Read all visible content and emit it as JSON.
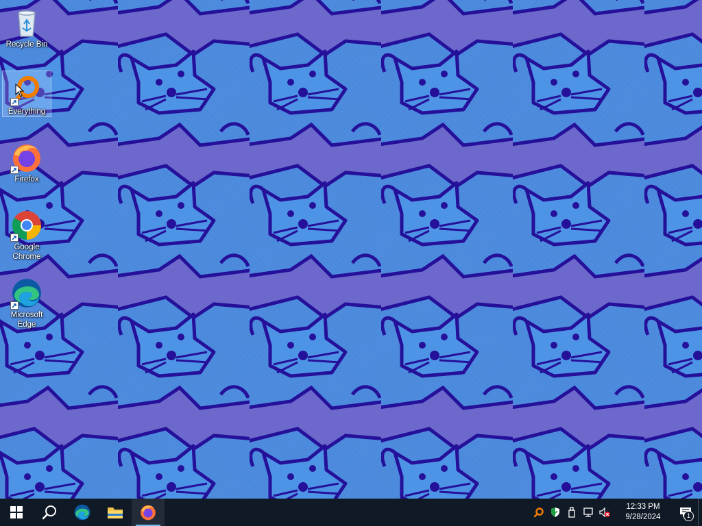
{
  "desktop": {
    "icons": [
      {
        "label": "Recycle Bin",
        "icon": "recycle-bin-icon"
      },
      {
        "label": "Everything",
        "icon": "everything-search-icon"
      },
      {
        "label": "Firefox",
        "icon": "firefox-icon"
      },
      {
        "label": "Google Chrome",
        "icon": "chrome-icon"
      },
      {
        "label": "Microsoft Edge",
        "icon": "edge-icon"
      }
    ]
  },
  "taskbar": {
    "buttons": [
      "windows-start-icon",
      "search-icon",
      "edge-icon",
      "file-explorer-icon",
      "firefox-icon"
    ],
    "active": "firefox-icon",
    "tray_icons": [
      "everything-search-icon",
      "windows-security-icon",
      "usb-drive-icon",
      "network-icon",
      "volume-muted-icon"
    ],
    "clock": {
      "time": "12:33 PM",
      "date": "9/28/2024"
    },
    "notification_count": "1"
  },
  "colors": {
    "wallpaper_light": "#4a8be0",
    "wallpaper_dark": "#6d68cc",
    "wallpaper_line": "#25109a",
    "taskbar_bg": "#101a26",
    "accent": "#76b9ed"
  }
}
